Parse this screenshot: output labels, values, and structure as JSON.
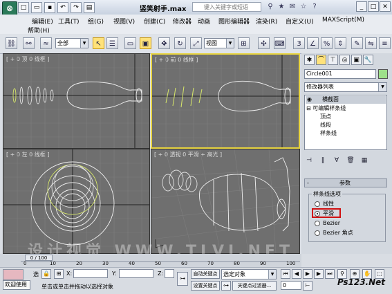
{
  "titlebar": {
    "app_icon": "3ds Max logo",
    "quick_access": [
      "new-icon",
      "open-icon",
      "save-icon",
      "undo-icon",
      "redo-icon",
      "project-icon"
    ],
    "title": "竖笑射手.max",
    "search_placeholder": "键入关键字或短语"
  },
  "menubar": {
    "items": [
      "编辑(E)",
      "工具(T)",
      "组(G)",
      "视图(V)",
      "创建(C)",
      "修改器",
      "动画",
      "图形编辑器",
      "渲染(R)",
      "自定义(U)",
      "MAXScript(M)",
      "帮助(H)"
    ]
  },
  "toolbar": {
    "selection_filter": "全部",
    "reference_coord": "视图",
    "snap_value": "3",
    "angle_value": "%"
  },
  "viewports": [
    {
      "label": "[ + 0 顶 0 线框 ]",
      "active": false
    },
    {
      "label": "[ + 0 前 0 线框 ]",
      "active": true
    },
    {
      "label": "[ + 0 左 0 线框 ]",
      "active": false
    },
    {
      "label": "[ + 0 透视 0 平滑 + 高光 ]",
      "active": false
    }
  ],
  "command_panel": {
    "object_name": "Circle001",
    "object_color": "#9ee08a",
    "modifier_list": "修改器列表",
    "stack": [
      {
        "label": "横截面",
        "level": 0,
        "highlight": true
      },
      {
        "label": "可编辑样条线",
        "level": 0
      },
      {
        "label": "顶点",
        "level": 1
      },
      {
        "label": "线段",
        "level": 1
      },
      {
        "label": "样条线",
        "level": 1
      }
    ],
    "rollout_toggle": "-",
    "rollout_title": "参数",
    "group_title": "样条线选项",
    "options": [
      "线性",
      "平滑",
      "Bezier",
      "Bezier 角点"
    ],
    "selected_option": "平滑"
  },
  "timeline": {
    "frame_counter": "0 / 100",
    "ticks": [
      "0",
      "10",
      "20",
      "30",
      "40",
      "50",
      "60",
      "70",
      "80",
      "90",
      "100"
    ]
  },
  "statusbar": {
    "welcome": "欢迎使用",
    "select_label": "选",
    "x_label": "X:",
    "y_label": "Y:",
    "z_label": "Z:",
    "auto_key": "自动关键点",
    "set_key": "设置关键点",
    "selection_set": "选定对象",
    "key_filters": "关键点过滤器...",
    "prompt": "单击或单击并拖动以选择对象",
    "frame_value": "0"
  },
  "watermark": "设计视觉 WWW.TLVI.NET",
  "corner_watermark": "Ps123.Net"
}
